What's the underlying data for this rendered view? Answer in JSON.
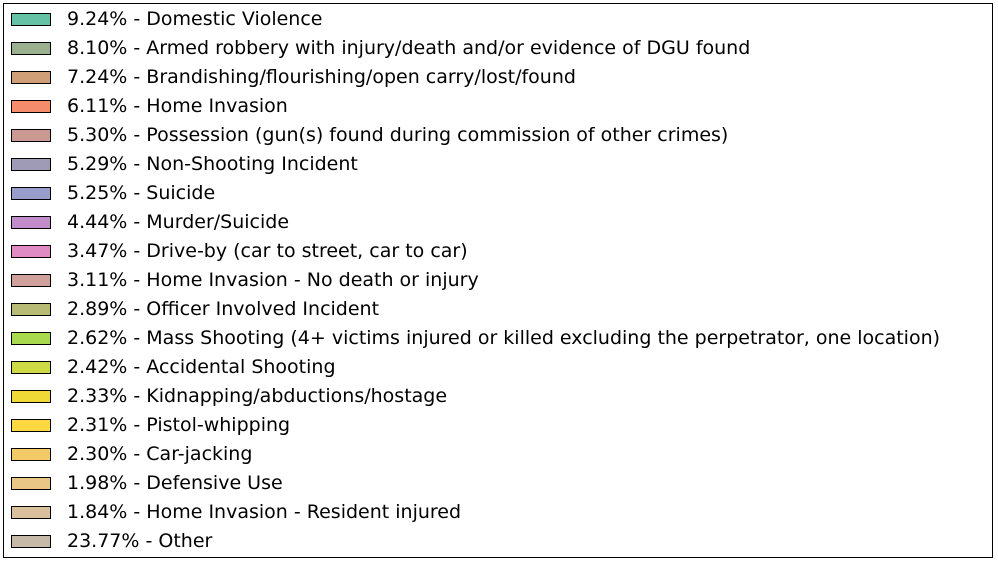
{
  "chart_data": {
    "type": "pie",
    "title": "",
    "legend_placement": "full",
    "slices": [
      {
        "value": 9.24,
        "label": "9.24% - Domestic Violence",
        "color": "#66c2a5"
      },
      {
        "value": 8.1,
        "label": "8.10% - Armed robbery with injury/death and/or evidence of DGU found",
        "color": "#9bb08e"
      },
      {
        "value": 7.24,
        "label": "7.24% - Brandishing/flourishing/open carry/lost/found",
        "color": "#d09e77"
      },
      {
        "value": 6.11,
        "label": "6.11% - Home Invasion",
        "color": "#f58d6c"
      },
      {
        "value": 5.3,
        "label": "5.30% - Possession (gun(s) found during commission of other crimes)",
        "color": "#ca9992"
      },
      {
        "value": 5.29,
        "label": "5.29% - Non-Shooting Incident",
        "color": "#9f9bb6"
      },
      {
        "value": 5.25,
        "label": "5.25% - Suicide",
        "color": "#989dcb"
      },
      {
        "value": 4.44,
        "label": "4.44% - Murder/Suicide",
        "color": "#c08cc9"
      },
      {
        "value": 3.47,
        "label": "3.47% - Drive-by (car to street, car to car)",
        "color": "#e08bc3"
      },
      {
        "value": 3.11,
        "label": "3.11% - Home Invasion - No death or injury",
        "color": "#d0a19b"
      },
      {
        "value": 2.89,
        "label": "2.89% - Officer Involved Incident",
        "color": "#b7bb75"
      },
      {
        "value": 2.62,
        "label": "2.62% - Mass Shooting (4+ victims injured or killed excluding the perpetrator, one location)",
        "color": "#a8d94e"
      },
      {
        "value": 2.42,
        "label": "2.42% - Accidental Shooting",
        "color": "#cdd945"
      },
      {
        "value": 2.33,
        "label": "2.33% - Kidnapping/abductions/hostage",
        "color": "#efd936"
      },
      {
        "value": 2.31,
        "label": "2.31% - Pistol-whipping",
        "color": "#fdd843"
      },
      {
        "value": 2.3,
        "label": "2.30% - Car-jacking",
        "color": "#f2cb68"
      },
      {
        "value": 1.98,
        "label": "1.98% - Defensive Use",
        "color": "#e9c586"
      },
      {
        "value": 1.84,
        "label": "1.84% - Home Invasion - Resident injured",
        "color": "#d9bf9b"
      },
      {
        "value": 23.77,
        "label": "23.77% - Other",
        "color": "#c6b9a8"
      }
    ]
  }
}
